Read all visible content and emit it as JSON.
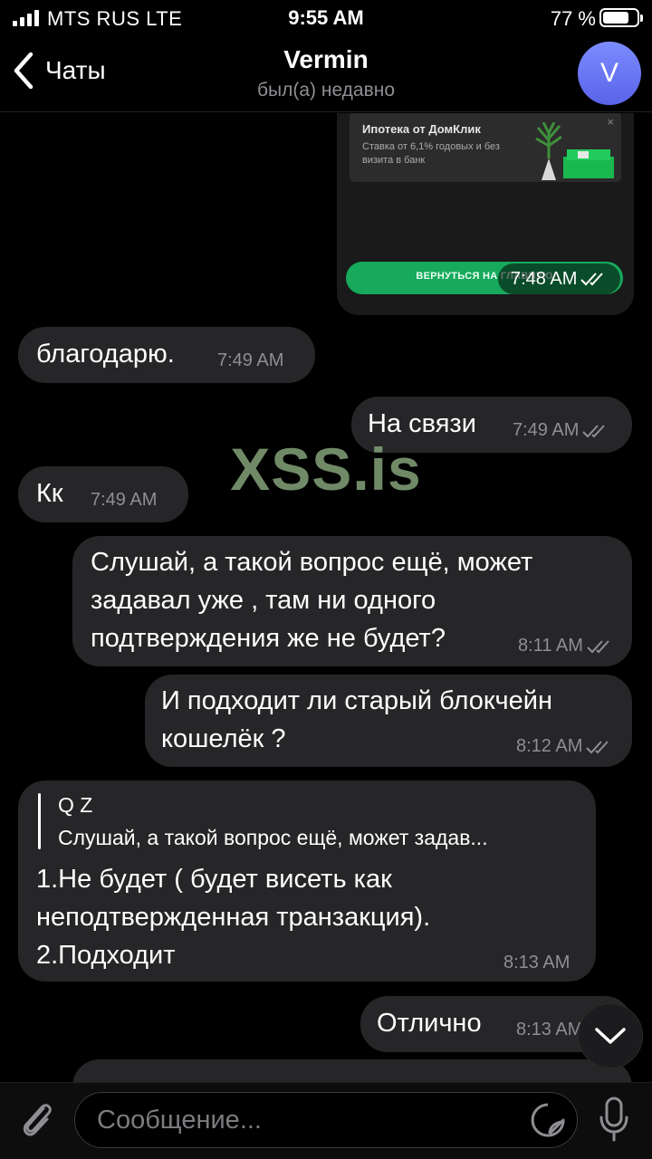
{
  "status_bar": {
    "carrier": "MTS RUS  LTE",
    "time": "9:55 AM",
    "battery": "77 %",
    "battery_level": 0.77
  },
  "header": {
    "back_label": "Чаты",
    "title": "Vermin",
    "subtitle": "был(а) недавно",
    "avatar_letter": "V"
  },
  "ad_message": {
    "ad_title": "Ипотека от ДомКлик",
    "ad_text": "Ставка от 6,1% годовых и без визита в банк",
    "ad_close": "×",
    "button_label": "ВЕРНУТЬСЯ НА ГЛАВНУЮ",
    "time": "7:48 AM"
  },
  "messages": [
    {
      "text": "благодарю.",
      "time": "7:49 AM",
      "outgoing": false
    },
    {
      "text": "На связи",
      "time": "7:49 AM",
      "outgoing": true,
      "read": true
    },
    {
      "text": "Кк",
      "time": "7:49 AM",
      "outgoing": false
    },
    {
      "lines": [
        "Слушай, а такой вопрос ещё, может",
        "задавал уже , там ни одного",
        "подтверждения же не будет?"
      ],
      "time": "8:11 AM",
      "outgoing": true,
      "read": true
    },
    {
      "lines": [
        "И подходит ли старый блокчейн",
        "кошелёк ?"
      ],
      "time": "8:12 AM",
      "outgoing": true,
      "read": true
    },
    {
      "quote_name": "Q Z",
      "quote_text": "Слушай, а такой вопрос ещё, может задав...",
      "lines": [
        "1.Не будет ( будет висеть как",
        "неподтвержденная транзакция).",
        "2.Подходит"
      ],
      "time": "8:13 AM",
      "outgoing": false
    },
    {
      "text": "Отлично",
      "time": "8:13 AM",
      "outgoing": true,
      "read": true
    }
  ],
  "watermark": "XSS.is",
  "input": {
    "placeholder": "Сообщение..."
  },
  "icons": {
    "back": "chevron-left-icon",
    "attach": "paperclip-icon",
    "sticker": "sticker-icon",
    "mic": "microphone-icon",
    "scroll": "chevron-down-icon",
    "read": "double-check-icon"
  }
}
